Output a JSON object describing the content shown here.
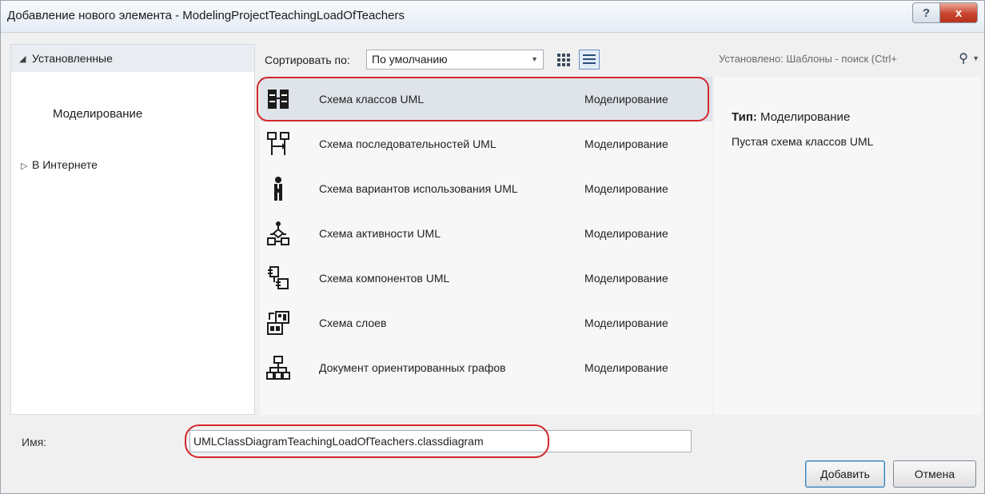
{
  "window": {
    "title": "Добавление нового элемента - ModelingProjectTeachingLoadOfTeachers",
    "help_label": "?",
    "close_label": "x"
  },
  "left_pane": {
    "installed": "Установленные",
    "modeling": "Моделирование",
    "online": "В Интернете"
  },
  "toolbar": {
    "sort_label": "Сортировать по:",
    "sort_value": "По умолчанию"
  },
  "search": {
    "placeholder": "Установлено: Шаблоны - поиск (Ctrl+"
  },
  "templates": [
    {
      "name": "Схема классов UML",
      "category": "Моделирование",
      "icon": "class-diagram-icon",
      "selected": true
    },
    {
      "name": "Схема последовательностей UML",
      "category": "Моделирование",
      "icon": "sequence-diagram-icon"
    },
    {
      "name": "Схема вариантов использования UML",
      "category": "Моделирование",
      "icon": "use-case-diagram-icon"
    },
    {
      "name": "Схема активности UML",
      "category": "Моделирование",
      "icon": "activity-diagram-icon"
    },
    {
      "name": "Схема компонентов UML",
      "category": "Моделирование",
      "icon": "component-diagram-icon"
    },
    {
      "name": "Схема слоев",
      "category": "Моделирование",
      "icon": "layer-diagram-icon"
    },
    {
      "name": "Документ ориентированных графов",
      "category": "Моделирование",
      "icon": "directed-graph-icon"
    }
  ],
  "details": {
    "type_label": "Тип:",
    "type_value": "Моделирование",
    "description": "Пустая схема классов UML"
  },
  "bottom": {
    "name_label": "Имя:",
    "name_value": "UMLClassDiagramTeachingLoadOfTeachers.classdiagram",
    "add_button": "Добавить",
    "cancel_button": "Отмена"
  },
  "colors": {
    "highlight_outline": "#d3272b",
    "selected_row": "#dfe3ea"
  }
}
